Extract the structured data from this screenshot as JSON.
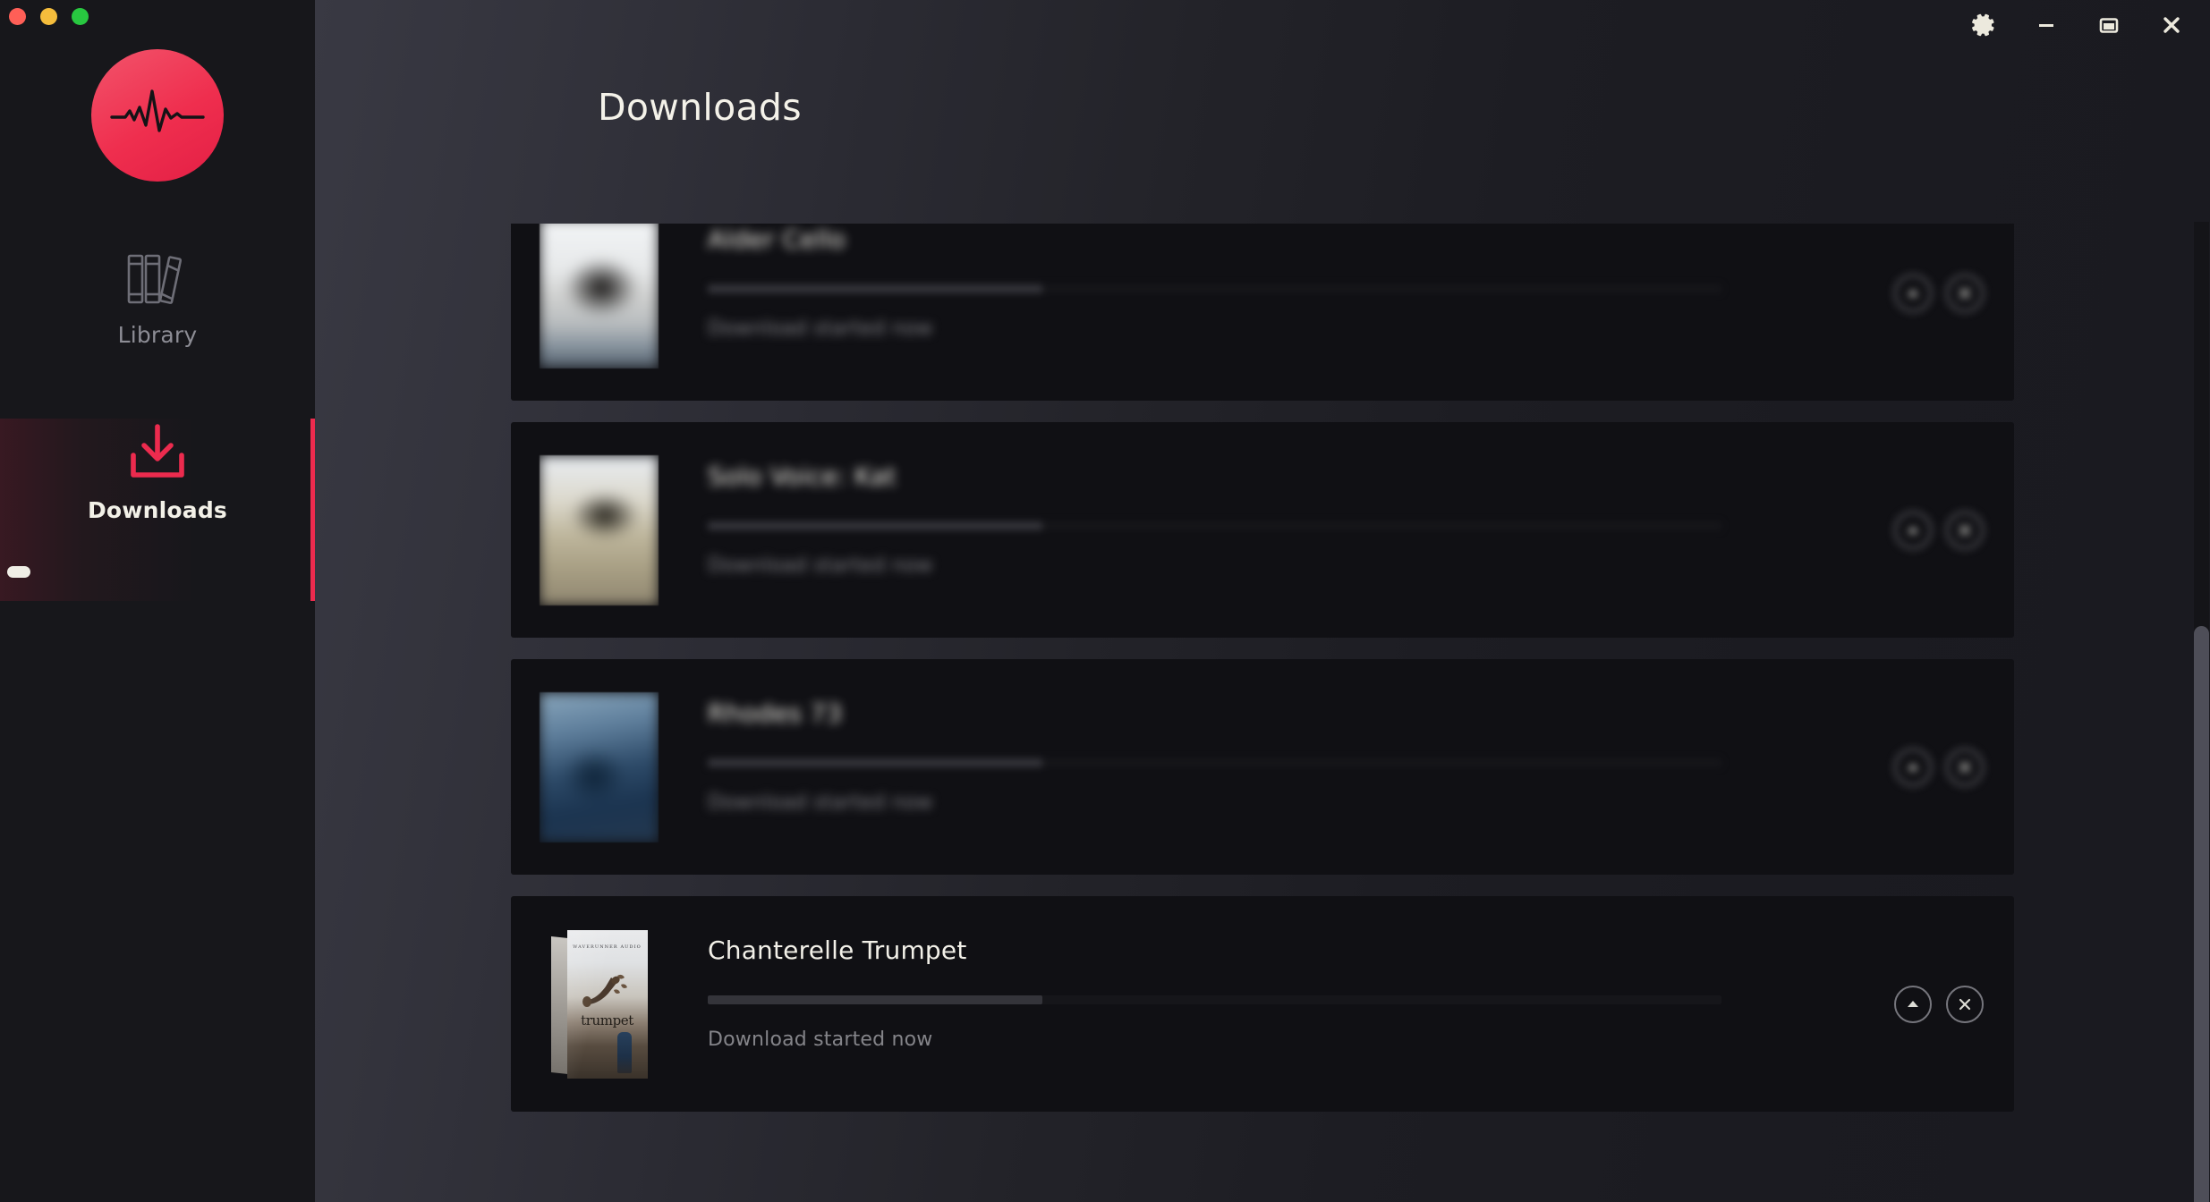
{
  "window": {
    "traffic_lights": [
      {
        "name": "close",
        "color": "#ff5f57"
      },
      {
        "name": "minimize",
        "color": "#f5bd3c"
      },
      {
        "name": "maximize",
        "color": "#28c840"
      }
    ],
    "controls": [
      {
        "name": "settings-gear",
        "icon": "gear-icon",
        "label": "Settings"
      },
      {
        "name": "minimize",
        "icon": "minimize-icon",
        "label": "Minimize"
      },
      {
        "name": "maximize",
        "icon": "maximize-icon",
        "label": "Maximize"
      },
      {
        "name": "close",
        "icon": "close-icon",
        "label": "Close"
      }
    ]
  },
  "sidebar": {
    "logo_icon": "waveform-logo-icon",
    "accent_color": "#ec2b4e",
    "items": [
      {
        "label": "Library",
        "icon": "books-icon",
        "active": false
      },
      {
        "label": "Downloads",
        "icon": "download-icon",
        "active": true
      }
    ]
  },
  "header": {
    "title": "Downloads"
  },
  "downloads": {
    "status_text_default": "Download started now",
    "rows": [
      {
        "title": "Alder Cello",
        "status": "Download started now",
        "progress_percent": 33,
        "blurred": true,
        "thumb": "tb-a",
        "actions": [
          {
            "name": "pause-button",
            "icon": "chevron-up-icon"
          },
          {
            "name": "cancel-button",
            "icon": "close-x-icon"
          }
        ]
      },
      {
        "title": "Solo Voice: Kat",
        "status": "Download started now",
        "progress_percent": 33,
        "blurred": true,
        "thumb": "tb-b",
        "actions": [
          {
            "name": "pause-button",
            "icon": "chevron-up-icon"
          },
          {
            "name": "cancel-button",
            "icon": "close-x-icon"
          }
        ]
      },
      {
        "title": "Rhodes 73",
        "status": "Download started now",
        "progress_percent": 33,
        "blurred": true,
        "thumb": "tb-c",
        "actions": [
          {
            "name": "pause-button",
            "icon": "chevron-up-icon"
          },
          {
            "name": "cancel-button",
            "icon": "close-x-icon"
          }
        ]
      },
      {
        "title": "Chanterelle Trumpet",
        "status": "Download started now",
        "progress_percent": 33,
        "blurred": false,
        "thumb": "boxart",
        "boxart": {
          "brand": "WAVERUNNER AUDIO",
          "product_word": "trumpet"
        },
        "actions": [
          {
            "name": "pause-button",
            "icon": "chevron-up-icon"
          },
          {
            "name": "cancel-button",
            "icon": "close-x-icon"
          }
        ]
      }
    ]
  },
  "scrollbar": {
    "orientation": "vertical",
    "thumb_top_percent": 41
  }
}
